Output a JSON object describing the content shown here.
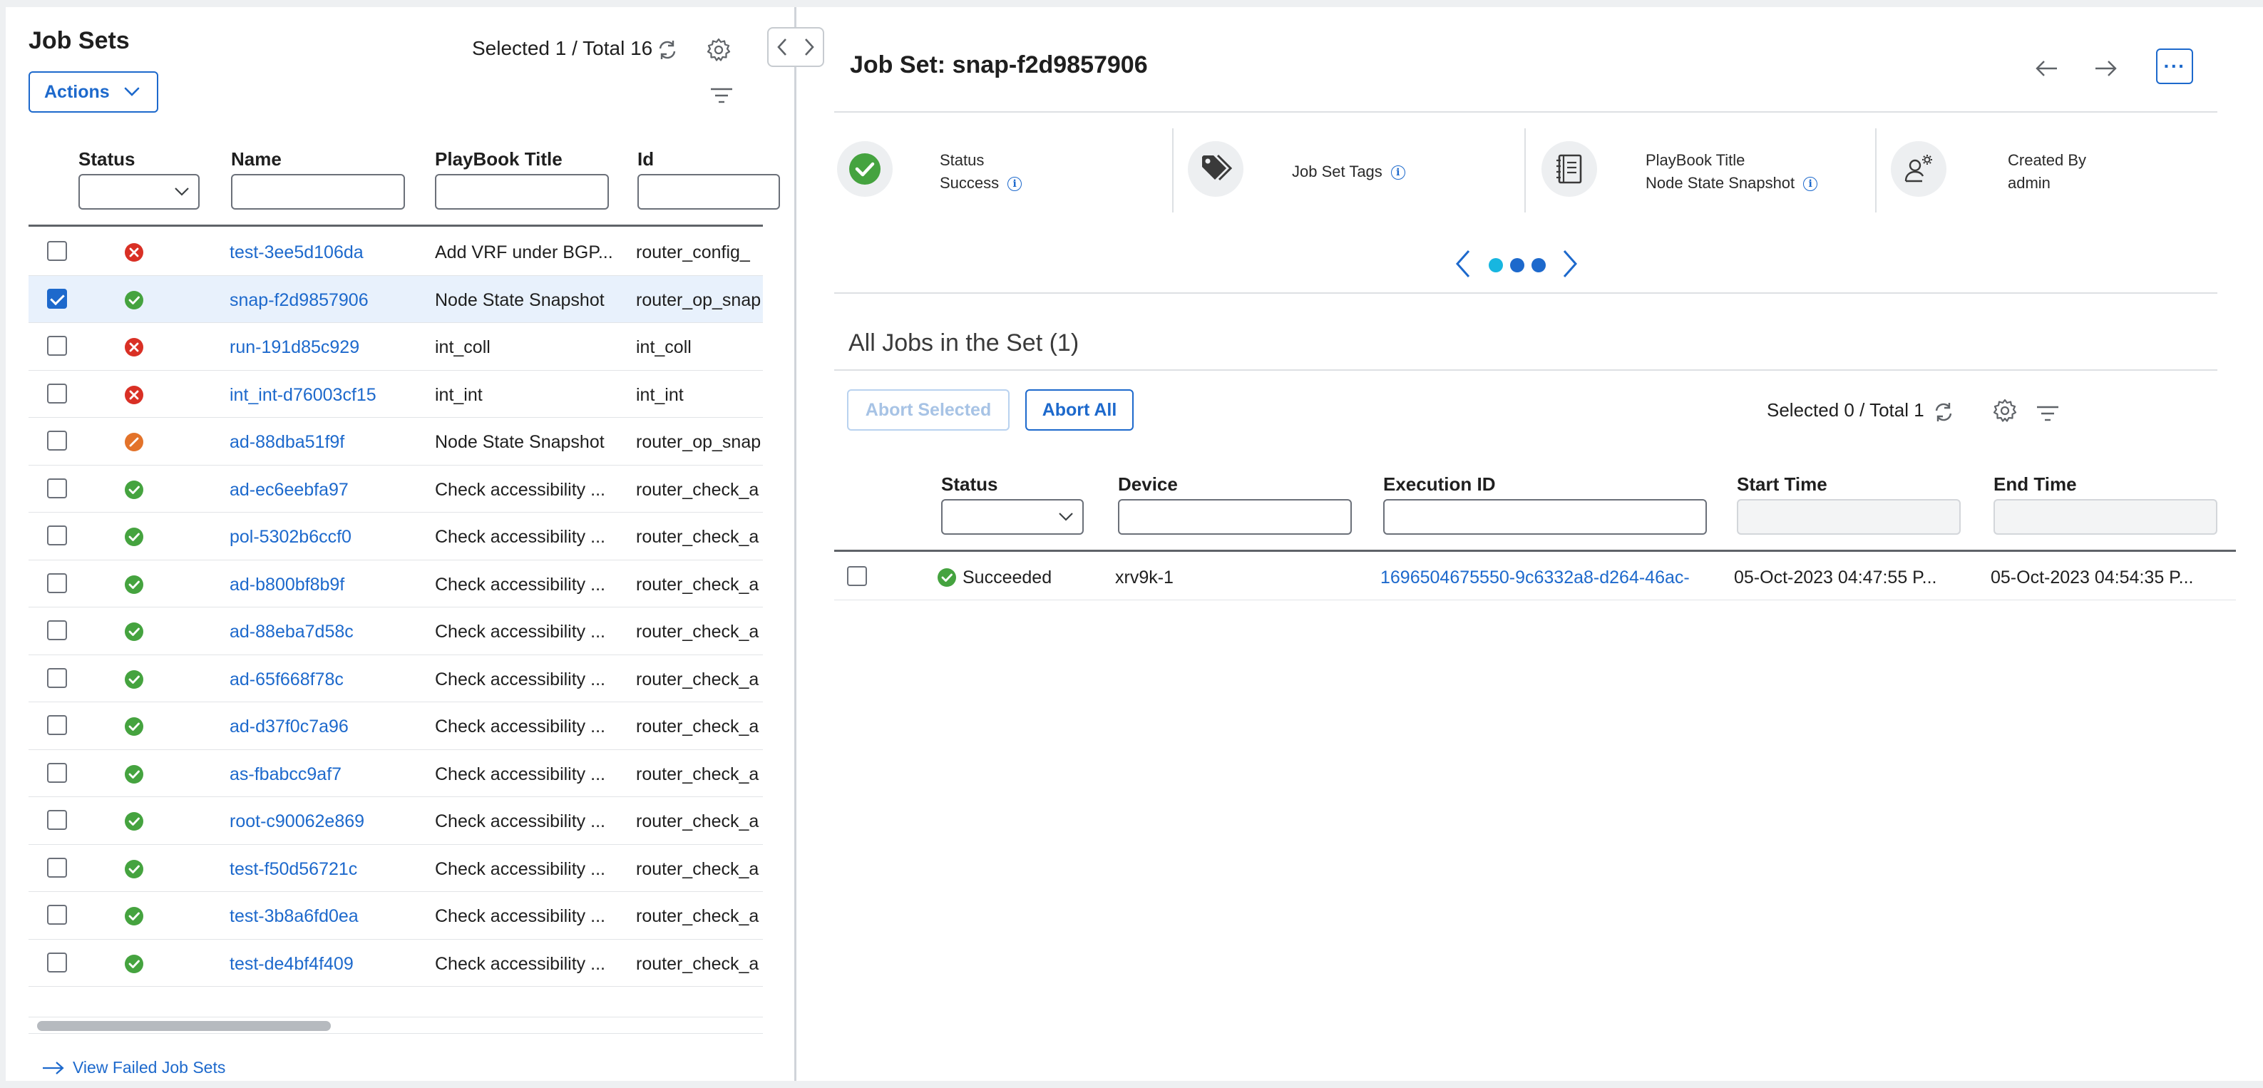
{
  "left_panel": {
    "title": "Job Sets",
    "actions_label": "Actions",
    "selection_summary": "Selected 1 / Total 16",
    "columns": {
      "status": "Status",
      "name": "Name",
      "playbook_title": "PlayBook Title",
      "id": "Id"
    },
    "rows": [
      {
        "status": "failed",
        "name": "test-3ee5d106da",
        "playbook": "Add VRF under BGP...",
        "id": "router_config_"
      },
      {
        "status": "success",
        "name": "snap-f2d9857906",
        "playbook": "Node State Snapshot",
        "id": "router_op_snap",
        "checked": true
      },
      {
        "status": "failed",
        "name": "run-191d85c929",
        "playbook": "int_coll",
        "id": "int_coll"
      },
      {
        "status": "failed",
        "name": "int_int-d76003cf15",
        "playbook": "int_int",
        "id": "int_int"
      },
      {
        "status": "aborted",
        "name": "ad-88dba51f9f",
        "playbook": "Node State Snapshot",
        "id": "router_op_snap"
      },
      {
        "status": "success",
        "name": "ad-ec6eebfa97",
        "playbook": "Check accessibility ...",
        "id": "router_check_a"
      },
      {
        "status": "success",
        "name": "pol-5302b6ccf0",
        "playbook": "Check accessibility ...",
        "id": "router_check_a"
      },
      {
        "status": "success",
        "name": "ad-b800bf8b9f",
        "playbook": "Check accessibility ...",
        "id": "router_check_a"
      },
      {
        "status": "success",
        "name": "ad-88eba7d58c",
        "playbook": "Check accessibility ...",
        "id": "router_check_a"
      },
      {
        "status": "success",
        "name": "ad-65f668f78c",
        "playbook": "Check accessibility ...",
        "id": "router_check_a"
      },
      {
        "status": "success",
        "name": "ad-d37f0c7a96",
        "playbook": "Check accessibility ...",
        "id": "router_check_a"
      },
      {
        "status": "success",
        "name": "as-fbabcc9af7",
        "playbook": "Check accessibility ...",
        "id": "router_check_a"
      },
      {
        "status": "success",
        "name": "root-c90062e869",
        "playbook": "Check accessibility ...",
        "id": "router_check_a"
      },
      {
        "status": "success",
        "name": "test-f50d56721c",
        "playbook": "Check accessibility ...",
        "id": "router_check_a"
      },
      {
        "status": "success",
        "name": "test-3b8a6fd0ea",
        "playbook": "Check accessibility ...",
        "id": "router_check_a"
      },
      {
        "status": "success",
        "name": "test-de4bf4f409",
        "playbook": "Check accessibility ...",
        "id": "router_check_a"
      }
    ],
    "view_failed_label": "View Failed Job Sets"
  },
  "right_panel": {
    "title": "Job Set: snap-f2d9857906",
    "cards": {
      "status_label": "Status",
      "status_value": "Success",
      "tags_label": "Job Set Tags",
      "playbook_label": "PlayBook Title",
      "playbook_value": "Node State Snapshot",
      "created_by_label": "Created By",
      "created_by_value": "admin"
    },
    "more_label": "···",
    "info_glyph": "i",
    "pager": {
      "pages": 3,
      "current": 1
    },
    "section_title": "All Jobs in the Set (1)",
    "abort_selected_label": "Abort Selected",
    "abort_all_label": "Abort All",
    "selection_summary": "Selected 0 / Total 1",
    "columns": {
      "status": "Status",
      "device": "Device",
      "execution_id": "Execution ID",
      "start_time": "Start Time",
      "end_time": "End Time"
    },
    "jobs": [
      {
        "status": "Succeeded",
        "device": "xrv9k-1",
        "execution_id": "1696504675550-9c6332a8-d264-46ac-",
        "start_time": "05-Oct-2023 04:47:55 P...",
        "end_time": "05-Oct-2023 04:54:35 P..."
      }
    ]
  },
  "icons": {
    "refresh": "refresh-icon",
    "settings": "gear-icon",
    "filter": "filter-icon",
    "collapse": "chevron-left-icon",
    "expand": "chevron-right-icon",
    "back": "arrow-left-icon",
    "forward": "arrow-right-icon",
    "tag": "tag-icon",
    "notebook": "notebook-icon",
    "user": "user-gear-icon"
  },
  "colors": {
    "accent": "#1d69cc",
    "success": "#45a33f",
    "failed": "#d93025",
    "aborted": "#e3732a",
    "selected_row": "#e8f1fc",
    "pager_active": "#17b6e0",
    "pager_inactive": "#1d69cc"
  }
}
